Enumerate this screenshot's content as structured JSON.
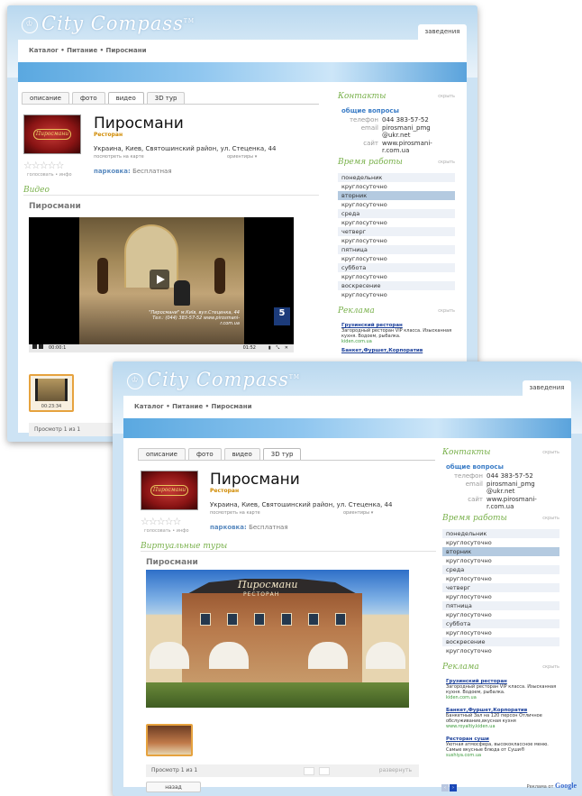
{
  "logo_text": "City Compass",
  "logo_tm": "TM",
  "top_tab": "заведения",
  "breadcrumb": "Каталог  •  Питание  •  Пиросмани",
  "tabs": [
    "описание",
    "фото",
    "видео",
    "3D тур"
  ],
  "restaurant": {
    "name": "Пиросмани",
    "type": "Ресторан",
    "address": "Украина, Киев, Святошинский район, ул. Стеценка, 44",
    "map_link": "посмотреть на карте",
    "orient": "ориентиры ▾",
    "parking_label": "парковка:",
    "parking_value": "Бесплатная",
    "stars": "☆☆☆☆☆",
    "stars_sub": "голосовать • инфо",
    "logo_plaque": "Пиросмани"
  },
  "screen1": {
    "section_title": "Видео",
    "media_title": "Пиросмани",
    "video_caption": "\"Пиросмани\" м.Київ, вул.Стеценка, 44 Тел.: (044) 383-57-52 www.pirosmani-r.com.ua",
    "channel": "5",
    "time_left": "00:00:1",
    "time_right": "01:52",
    "thumb_duration": "00:23:34",
    "pager": "Просмотр 1 из 1"
  },
  "screen2": {
    "section_title": "Виртуальные туры",
    "media_title": "Пиросмани",
    "photo_sign": "Пиросмани",
    "photo_sign2": "РЕСТОРАН",
    "pager": "Просмотр 1 из 1",
    "expand": "развернуть",
    "back": "назад"
  },
  "sidebar": {
    "contacts_title": "Контакты",
    "close": "скрыть",
    "general": "общие вопросы",
    "phone_label": "телефон",
    "phone": "044 383-57-52",
    "email_label": "email",
    "email": "pirosmani_pmg @ukr.net",
    "site_label": "сайт",
    "site": "www.pirosmani-r.com.ua",
    "hours_title": "Время работы",
    "hours": [
      "понедельник",
      "круглосуточно",
      "вторник",
      "круглосуточно",
      "среда",
      "круглосуточно",
      "четверг",
      "круглосуточно",
      "пятница",
      "круглосуточно",
      "суббота",
      "круглосуточно",
      "воскресение",
      "круглосуточно"
    ],
    "ads_title": "Реклама",
    "ads": [
      {
        "title": "Грузинский ресторан",
        "text": "Загородный ресторан VIP класса. Изысканная кухня. Водоем, рыбалка.",
        "url": "kiden.com.ua"
      },
      {
        "title": "Банкет,Фуршет,Корпоратив",
        "text": "Банкетный Зал на 120 персон Отличное обслуживание,вкусная кухня",
        "url": "www.royaltiy.kiden.ua"
      },
      {
        "title": "Ресторан суши",
        "text": "Уютная атмосфера, высококлассное меню. Самые вкусные блюда от Суши®",
        "url": "sushiya.com.ua"
      }
    ],
    "google": "Реклама от",
    "google_brand": "Google"
  },
  "colors": {
    "accent": "#78b04a",
    "link": "#3a7cc6",
    "selected_day": "#b4cae0",
    "thumb_border": "#e6a23e"
  }
}
